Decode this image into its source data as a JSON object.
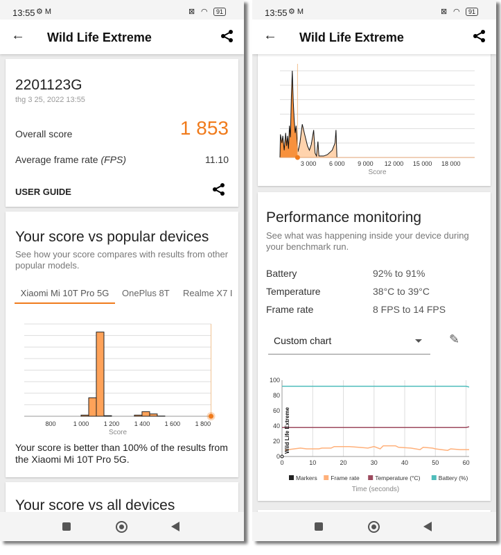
{
  "status": {
    "time": "13:55",
    "battery": "91"
  },
  "colors": {
    "accent": "#f07b1c",
    "frame_rate": "#ffb07a",
    "temperature": "#9c4a5e",
    "battery": "#4fbdbb"
  },
  "left": {
    "title": "Wild Life Extreme",
    "device": "2201123G",
    "date": "thg 3 25, 2022 13:55",
    "overall_label": "Overall score",
    "overall_value": "1 853",
    "fps_label": "Average frame rate ",
    "fps_unit": "(FPS)",
    "fps_value": "11.10",
    "user_guide": "USER GUIDE",
    "popular_title": "Your score vs popular devices",
    "popular_desc": "See how your score compares with results from other popular models.",
    "tabs": [
      "Xiaomi Mi 10T Pro 5G",
      "OnePlus 8T",
      "Realme X7 I"
    ],
    "result_text": "Your score is better than 100% of the results from the Xiaomi Mi 10T Pro 5G.",
    "all_title": "Your score vs all devices"
  },
  "right": {
    "title": "Wild Life Extreme",
    "perf_title": "Performance monitoring",
    "perf_desc": "See what was happening inside your device during your benchmark run.",
    "stats": [
      {
        "label": "Battery",
        "value": "92% to 91%"
      },
      {
        "label": "Temperature",
        "value": "38°C to 39°C"
      },
      {
        "label": "Frame rate",
        "value": "8 FPS to 14 FPS"
      }
    ],
    "dropdown": "Custom chart"
  },
  "chart_data": [
    {
      "type": "bar",
      "title": "",
      "xlabel": "Score",
      "xticks": [
        "800",
        "1 000",
        "1 200",
        "1 400",
        "1 600",
        "1 800"
      ],
      "xlim": [
        627,
        1855
      ],
      "bins": [
        [
          1000,
          1050,
          0.1
        ],
        [
          1050,
          1100,
          1.6
        ],
        [
          1100,
          1150,
          7.3
        ],
        [
          1150,
          1200,
          0.05
        ],
        [
          1350,
          1400,
          0.1
        ],
        [
          1400,
          1450,
          0.4
        ],
        [
          1450,
          1500,
          0.2
        ],
        [
          1500,
          1550,
          0.02
        ]
      ],
      "your_score": 1853
    },
    {
      "type": "area",
      "xlabel": "Score",
      "xticks": [
        "3 000",
        "6 000",
        "9 000",
        "12 000",
        "15 000",
        "18 000"
      ],
      "xlim": [
        0,
        20500
      ],
      "points": [
        [
          0,
          0
        ],
        [
          50,
          1.6
        ],
        [
          200,
          1.0
        ],
        [
          300,
          1.5
        ],
        [
          450,
          0.5
        ],
        [
          600,
          1.7
        ],
        [
          700,
          0.8
        ],
        [
          800,
          1.5
        ],
        [
          900,
          0.6
        ],
        [
          1000,
          2.2
        ],
        [
          1100,
          1.4
        ],
        [
          1200,
          4.2
        ],
        [
          1300,
          6.0
        ],
        [
          1400,
          3.9
        ],
        [
          1500,
          2.6
        ],
        [
          1600,
          1.7
        ],
        [
          1700,
          2.2
        ],
        [
          1800,
          1.2
        ],
        [
          1900,
          0.4
        ],
        [
          2100,
          1.0
        ],
        [
          2350,
          2.3
        ],
        [
          2600,
          1.6
        ],
        [
          2900,
          0.8
        ],
        [
          3100,
          0.5
        ],
        [
          3300,
          0.9
        ],
        [
          3550,
          1.9
        ],
        [
          3700,
          0.3
        ],
        [
          3850,
          0.1
        ],
        [
          4000,
          1.1
        ],
        [
          4100,
          0.1
        ],
        [
          4600,
          0.1
        ],
        [
          5000,
          0.2
        ],
        [
          5500,
          0.5
        ],
        [
          5800,
          1.0
        ],
        [
          5900,
          1.9
        ],
        [
          6000,
          0
        ],
        [
          20500,
          0
        ]
      ],
      "your_score": 1853
    },
    {
      "type": "line",
      "xlabel": "Time (seconds)",
      "xticks": [
        "0",
        "10",
        "20",
        "30",
        "40",
        "50",
        "60"
      ],
      "yticks": [
        "0",
        "20",
        "40",
        "60",
        "80",
        "100"
      ],
      "xlim": [
        0,
        61
      ],
      "ylim": [
        0,
        100
      ],
      "marker_label": "Wild Life Extreme",
      "legend": [
        "Markers",
        "Frame rate",
        "Temperature (°C)",
        "Battery (%)"
      ],
      "series": [
        {
          "name": "Frame rate",
          "x": [
            1,
            2,
            4,
            6,
            8,
            12,
            13,
            16,
            17,
            22,
            25,
            28,
            30,
            32,
            33,
            37,
            38,
            42,
            45,
            46,
            49,
            50,
            54,
            55,
            58,
            61
          ],
          "y": [
            8,
            9,
            10,
            11,
            10,
            10,
            11,
            11,
            13,
            13,
            12,
            11,
            13,
            10,
            14,
            14,
            12,
            11,
            9,
            12,
            11,
            10,
            8,
            10,
            9,
            9
          ]
        },
        {
          "name": "Temperature (°C)",
          "x": [
            0,
            60,
            61
          ],
          "y": [
            38,
            38,
            39
          ]
        },
        {
          "name": "Battery (%)",
          "x": [
            0,
            60,
            61
          ],
          "y": [
            92,
            92,
            91
          ]
        }
      ]
    }
  ]
}
